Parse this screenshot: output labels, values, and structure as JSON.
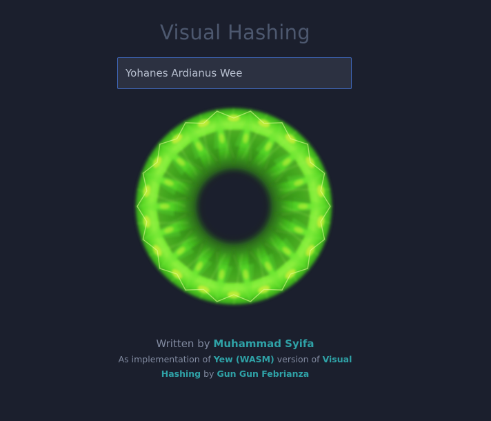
{
  "page": {
    "title": "Visual Hashing"
  },
  "input": {
    "value": "Yohanes Ardianus Wee"
  },
  "footer": {
    "written_by": "Written by",
    "author": "Muhammad Syifa",
    "impl_prefix": "As implementation of",
    "yew_link": "Yew (WASM)",
    "version_of": "version of",
    "vh_link": "Visual Hashing",
    "by": "by",
    "orig_author": "Gun Gun Febrianza"
  },
  "colors": {
    "background": "#1b1f2d",
    "accent": "#2fa2a7",
    "hash_green": "#58e02a",
    "hash_yellow": "#d8f03a"
  }
}
